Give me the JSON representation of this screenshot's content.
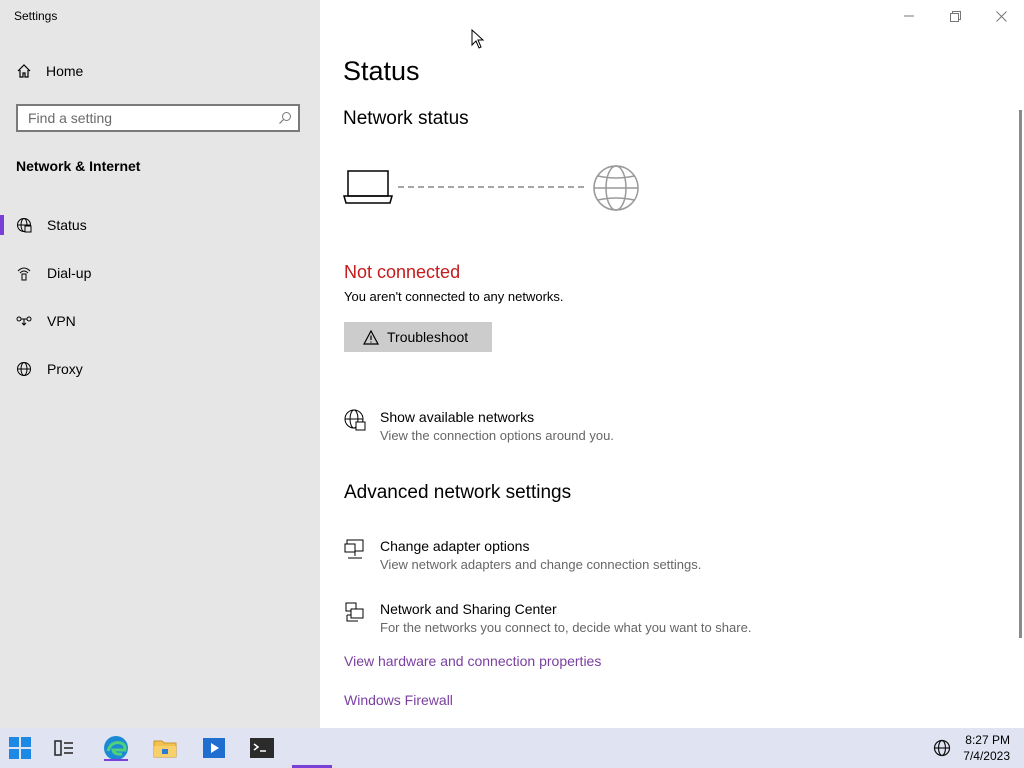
{
  "window": {
    "title": "Settings",
    "controls": [
      "minimize",
      "restore",
      "close"
    ]
  },
  "sidebar": {
    "home_label": "Home",
    "search_placeholder": "Find a setting",
    "section_title": "Network & Internet",
    "items": [
      {
        "label": "Status",
        "icon": "globe-status-icon",
        "active": true
      },
      {
        "label": "Dial-up",
        "icon": "dialup-icon",
        "active": false
      },
      {
        "label": "VPN",
        "icon": "vpn-icon",
        "active": false
      },
      {
        "label": "Proxy",
        "icon": "globe-icon",
        "active": false
      }
    ]
  },
  "main": {
    "title": "Status",
    "network_status_heading": "Network status",
    "connection_state": "Not connected",
    "connection_desc": "You aren't connected to any networks.",
    "troubleshoot_label": "Troubleshoot",
    "show_networks": {
      "title": "Show available networks",
      "desc": "View the connection options around you."
    },
    "advanced_heading": "Advanced network settings",
    "adapter": {
      "title": "Change adapter options",
      "desc": "View network adapters and change connection settings."
    },
    "sharing": {
      "title": "Network and Sharing Center",
      "desc": "For the networks you connect to, decide what you want to share."
    },
    "hardware_link": "View hardware and connection properties",
    "firewall_link": "Windows Firewall"
  },
  "taskbar": {
    "apps": [
      "start",
      "task-view",
      "edge",
      "file-explorer",
      "media",
      "terminal"
    ],
    "time": "8:27 PM",
    "date": "7/4/2023"
  },
  "colors": {
    "accent": "#7a3fd6",
    "error": "#c41a1a",
    "link": "#7a3fa0",
    "sidebar_bg": "#e6e6e6",
    "taskbar_bg": "#dfe3f2"
  }
}
